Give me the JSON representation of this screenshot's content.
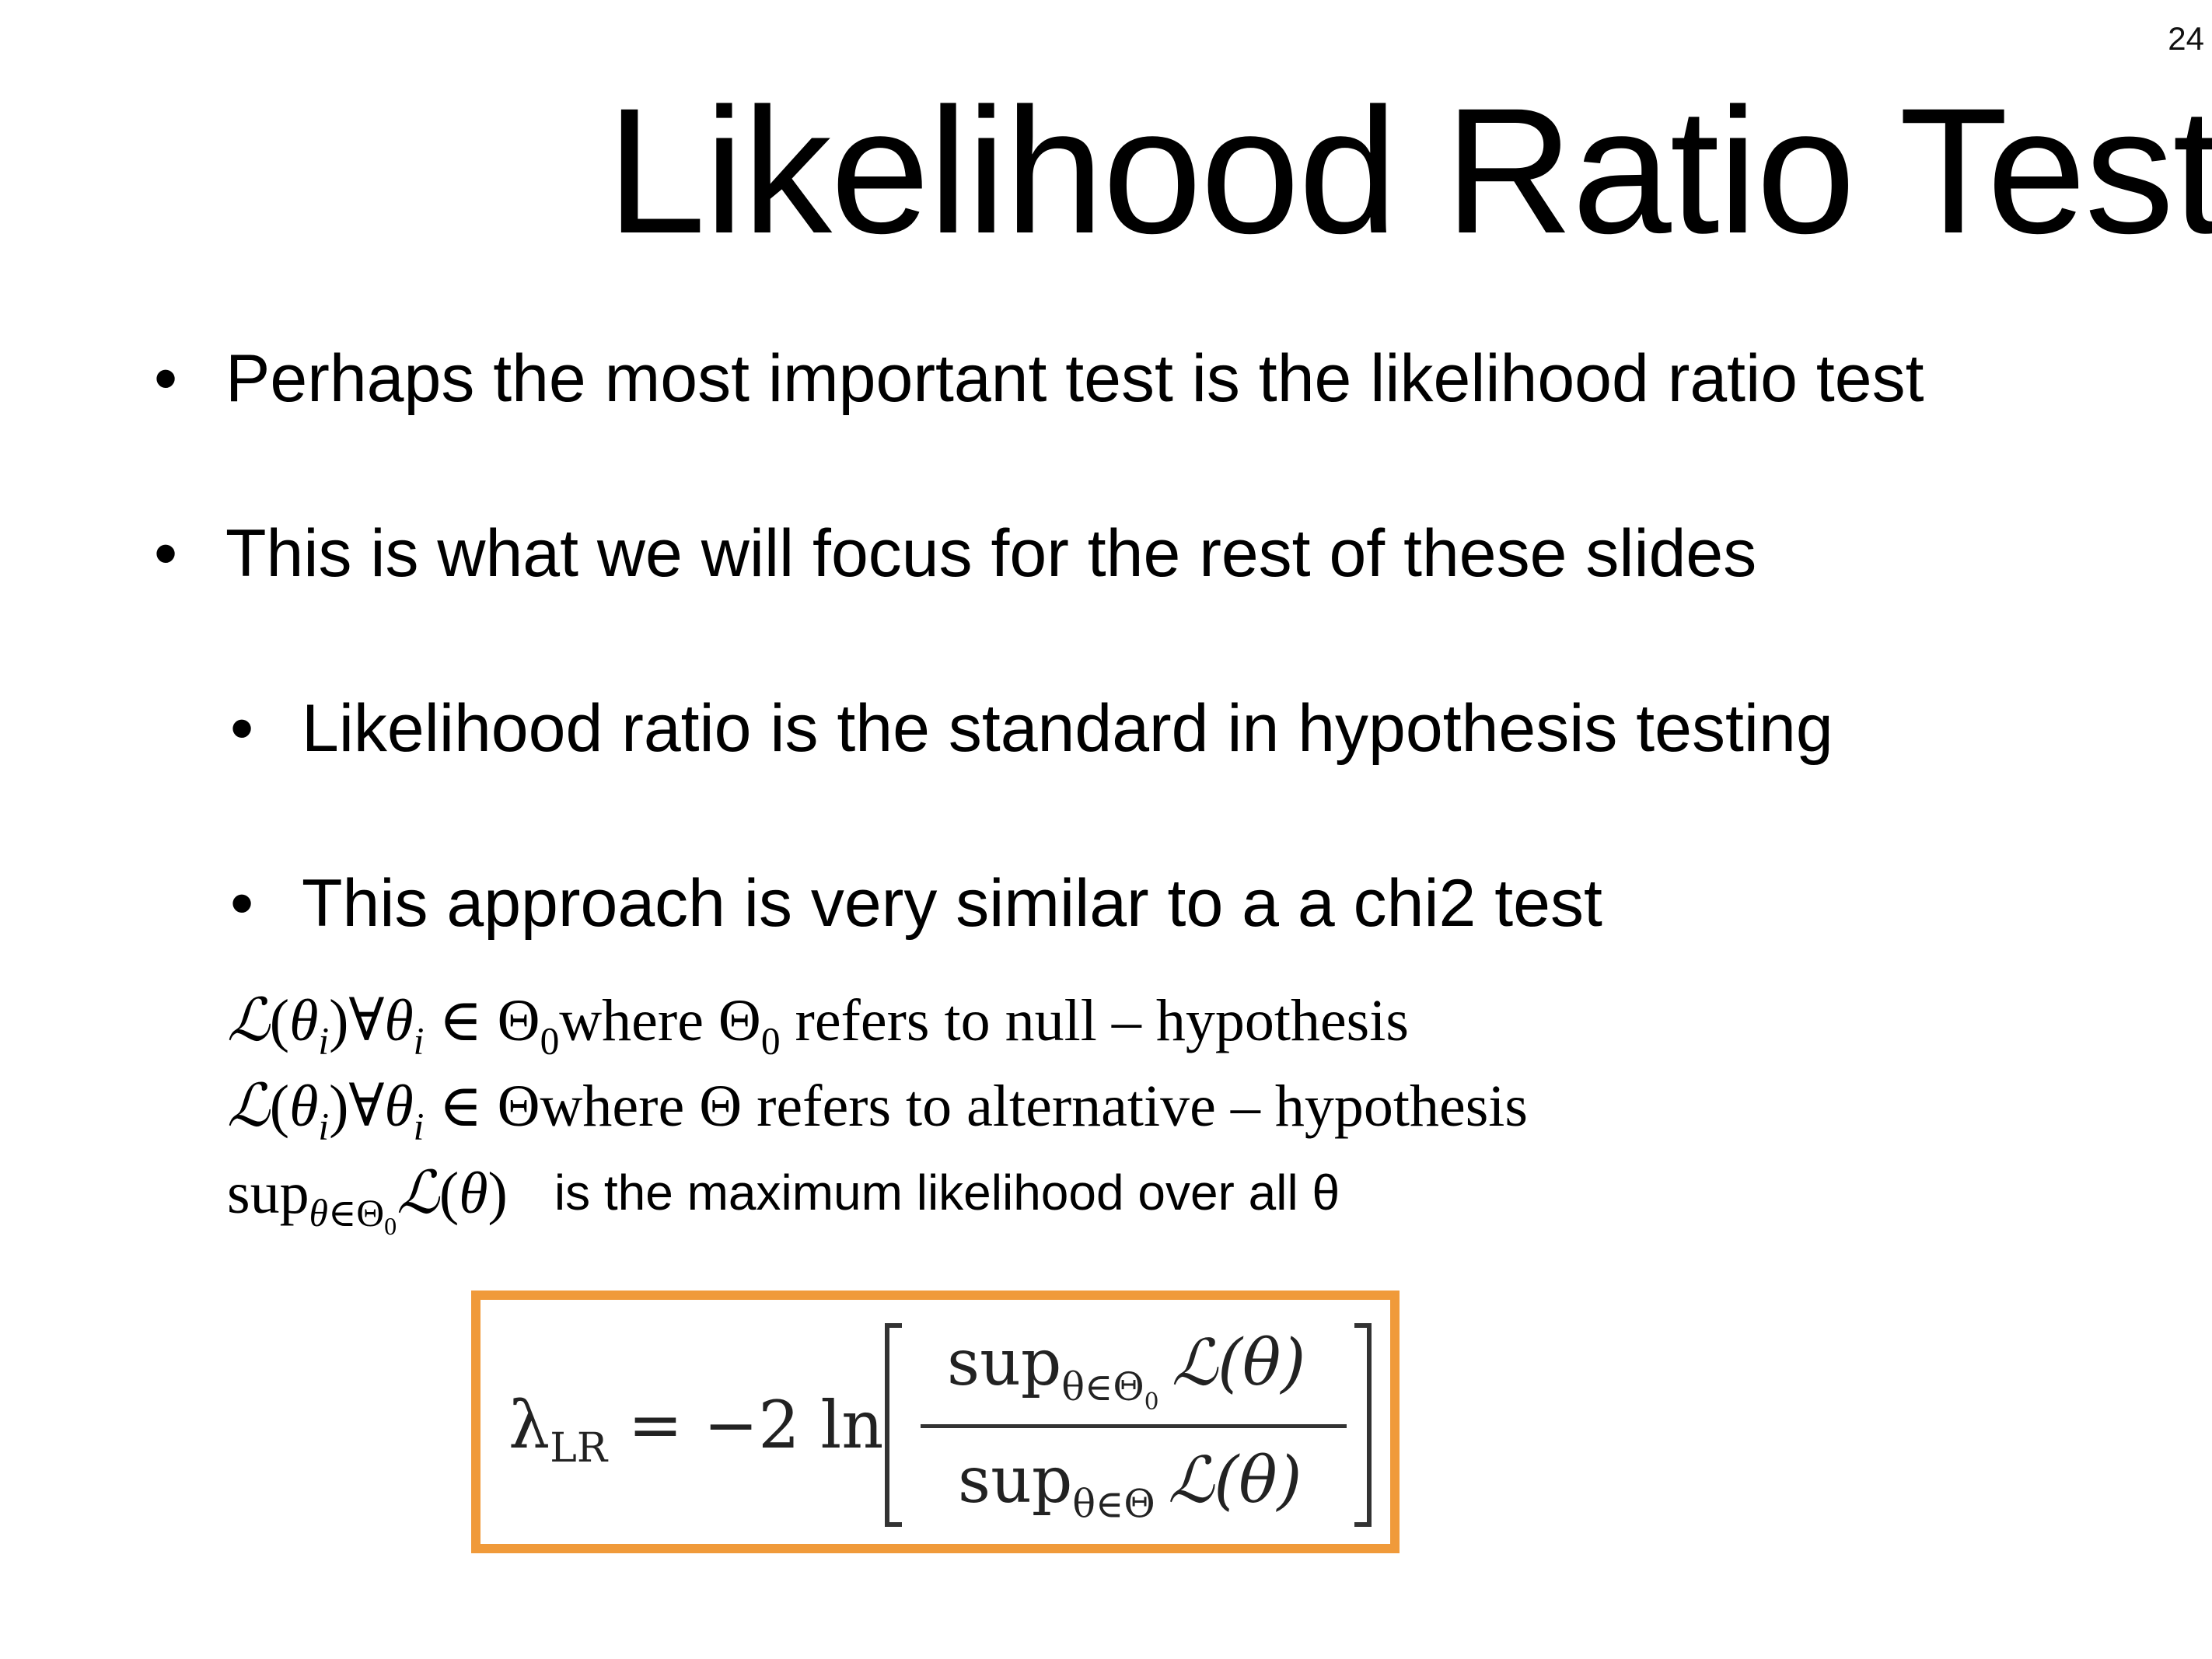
{
  "slide": {
    "page_number": "24",
    "title": "Likelihood Ratio Test",
    "bullets": [
      "Perhaps the most important test is the likelihood ratio test",
      "This is what we will focus for the rest of these slides"
    ],
    "sub_bullets": [
      "Likelihood ratio is the standard in hypothesis testing",
      "This approach is very similar to a a chi2 test"
    ],
    "bullet_symbol": "•",
    "math": {
      "line1_tail": " refers to null – hypothesis",
      "line2_tail": " refers to alternative – hypothesis",
      "line3_text": "is the maximum likelihood over all θ"
    },
    "formula": {
      "lhs_symbol": "λ",
      "lhs_sub": "LR",
      "equals_part": " = −2 ln",
      "sup": "sup",
      "num_sub": "θ∈Θ",
      "num_sub_index": "0",
      "den_sub": "θ∈Θ",
      "likelihood": "ℒ(θ)",
      "box_color": "#f09a3a"
    }
  }
}
